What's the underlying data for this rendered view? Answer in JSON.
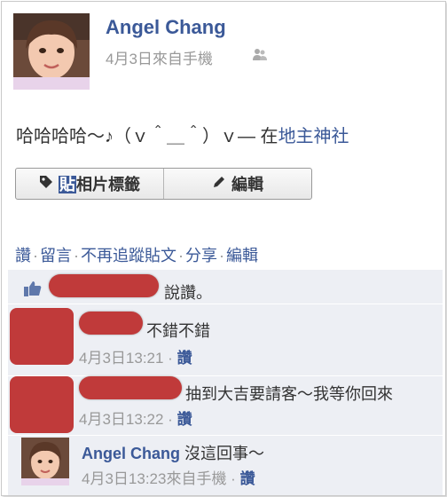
{
  "post": {
    "author": "Angel Chang",
    "meta": "4月3日來自手機",
    "status_text": "哈哈哈哈～♪（ｖ＾＿＾）ｖ— 在",
    "location": "地主神社"
  },
  "buttons": {
    "tag_hl": "貼",
    "tag_rest": "相片標籤",
    "edit": "編輯"
  },
  "actions": {
    "like": "讚",
    "comment": "留言",
    "unfollow": "不再追蹤貼文",
    "share": "分享",
    "edit": "編輯"
  },
  "like_text": "說讚。",
  "comments": [
    {
      "text": "不錯不錯",
      "time": "4月3日13:21",
      "like": "讚"
    },
    {
      "text": "抽到大吉要請客～我等你回來",
      "time": "4月3日13:22",
      "like": "讚"
    },
    {
      "author": "Angel Chang",
      "text": "沒這回事～",
      "time": "4月3日13:23來自手機",
      "like": "讚"
    }
  ],
  "colors": {
    "link": "#3b5998",
    "redact": "#c03a3a",
    "feedback_bg": "#edeff4"
  },
  "icons": [
    "people-icon",
    "tag-icon",
    "pencil-icon",
    "thumbs-up-icon"
  ]
}
